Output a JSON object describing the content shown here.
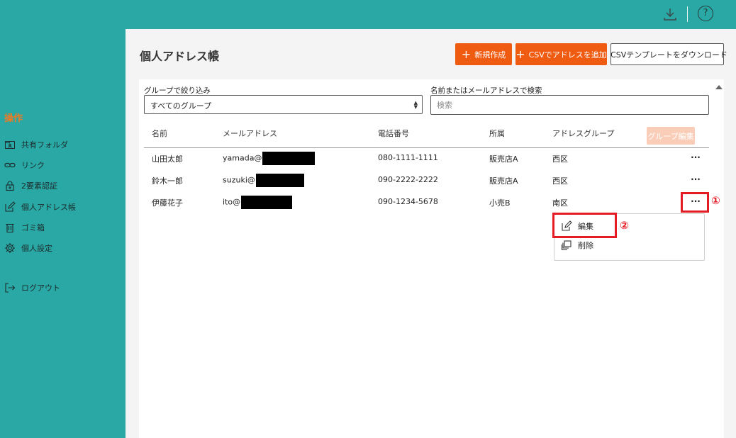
{
  "topbar": {
    "help_glyph": "?"
  },
  "sidebar": {
    "heading": "操作",
    "items": [
      {
        "label": "共有フォルダ",
        "icon": "shared-folder-icon"
      },
      {
        "label": "リンク",
        "icon": "link-icon"
      },
      {
        "label": "2要素認証",
        "icon": "lock-icon"
      },
      {
        "label": "個人アドレス帳",
        "icon": "edit-icon"
      },
      {
        "label": "ゴミ箱",
        "icon": "trash-icon"
      },
      {
        "label": "個人設定",
        "icon": "gear-icon"
      }
    ],
    "logout": "ログアウト"
  },
  "main": {
    "title": "個人アドレス帳",
    "buttons": {
      "new": "新規作成",
      "csv_add": "CSVでアドレスを追加",
      "csv_template": "CSVテンプレートをダウンロード"
    }
  },
  "filters": {
    "group_label": "グループで絞り込み",
    "group_value": "すべてのグループ",
    "search_label": "名前またはメールアドレスで検索",
    "search_placeholder": "検索"
  },
  "table": {
    "headers": [
      "名前",
      "メールアドレス",
      "電話番号",
      "所属",
      "アドレスグループ"
    ],
    "group_edit": "グループ編集",
    "more_glyph": "···",
    "rows": [
      {
        "name": "山田太郎",
        "email": "yamada@",
        "phone": "080-1111-1111",
        "dept": "販売店A",
        "group": "西区"
      },
      {
        "name": "鈴木一郎",
        "email": "suzuki@",
        "phone": "090-2222-2222",
        "dept": "販売店A",
        "group": "西区"
      },
      {
        "name": "伊藤花子",
        "email": "ito@",
        "phone": "090-1234-5678",
        "dept": "小売B",
        "group": "南区"
      }
    ]
  },
  "dropdown": {
    "edit": "編集",
    "delete": "削除"
  },
  "annotations": {
    "one": "①",
    "two": "②"
  },
  "colors": {
    "teal": "#2aa8a5",
    "orange": "#f05b12",
    "red": "#e41b22"
  }
}
